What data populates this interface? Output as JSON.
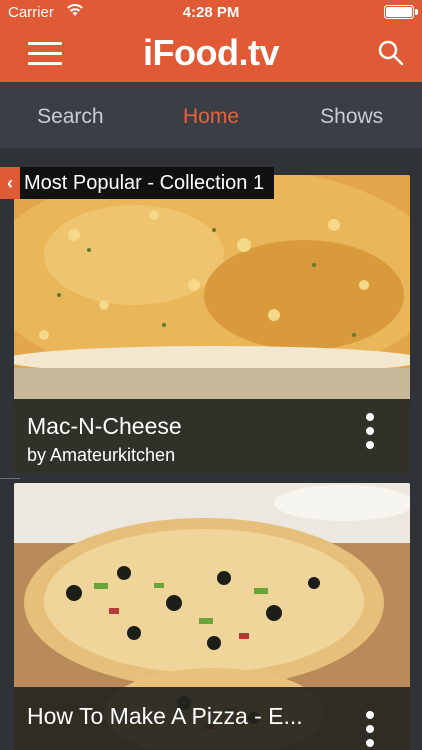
{
  "status_bar": {
    "carrier": "Carrier",
    "time": "4:28 PM"
  },
  "app_bar": {
    "logo": "iFood.tv"
  },
  "tabs": [
    {
      "label": "Search"
    },
    {
      "label": "Home",
      "active": true
    },
    {
      "label": "Shows"
    }
  ],
  "section": {
    "title": "Most Popular - Collection 1"
  },
  "cards": [
    {
      "title": "Mac-N-Cheese",
      "author": "by Amateurkitchen"
    },
    {
      "title": "How To Make A Pizza - E...",
      "author": ""
    }
  ],
  "colors": {
    "brand": "#e05a35",
    "active_tab": "#e5623c",
    "background": "#2f3338",
    "tab_bar": "#3b3f45"
  }
}
